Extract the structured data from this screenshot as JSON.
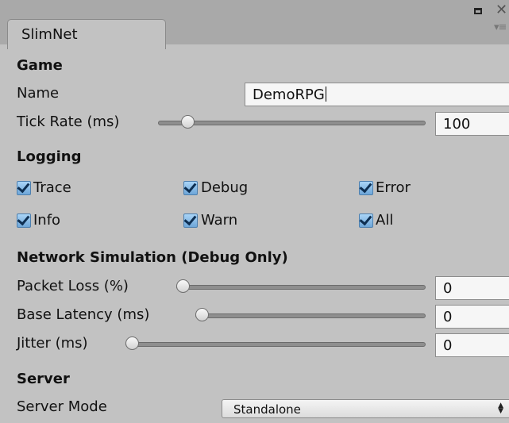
{
  "tab": {
    "title": "SlimNet"
  },
  "game": {
    "header": "Game",
    "name_label": "Name",
    "name_value": "DemoRPG",
    "tick_rate_label": "Tick Rate (ms)",
    "tick_rate_value": "100",
    "tick_rate_slider_fraction": 0.05
  },
  "logging": {
    "header": "Logging",
    "options": [
      {
        "label": "Trace",
        "checked": true
      },
      {
        "label": "Debug",
        "checked": true
      },
      {
        "label": "Error",
        "checked": true
      },
      {
        "label": "Info",
        "checked": true
      },
      {
        "label": "Warn",
        "checked": true
      },
      {
        "label": "All",
        "checked": true
      }
    ]
  },
  "network_simulation": {
    "header": "Network Simulation (Debug Only)",
    "packet_loss_label": "Packet Loss (%)",
    "packet_loss_value": "0",
    "base_latency_label": "Base Latency (ms)",
    "base_latency_value": "0",
    "jitter_label": "Jitter (ms)",
    "jitter_value": "0"
  },
  "server": {
    "header": "Server",
    "mode_label": "Server Mode",
    "mode_value": "Standalone"
  },
  "icons": [
    "maximize-icon",
    "close-icon",
    "menu-icon",
    "checkmark-icon",
    "dropdown-arrows-icon"
  ],
  "colors": {
    "panel": "#c2c2c2",
    "tab_bar": "#a9a9a9",
    "checkbox": "#7fb6e6",
    "field": "#f6f6f6"
  }
}
